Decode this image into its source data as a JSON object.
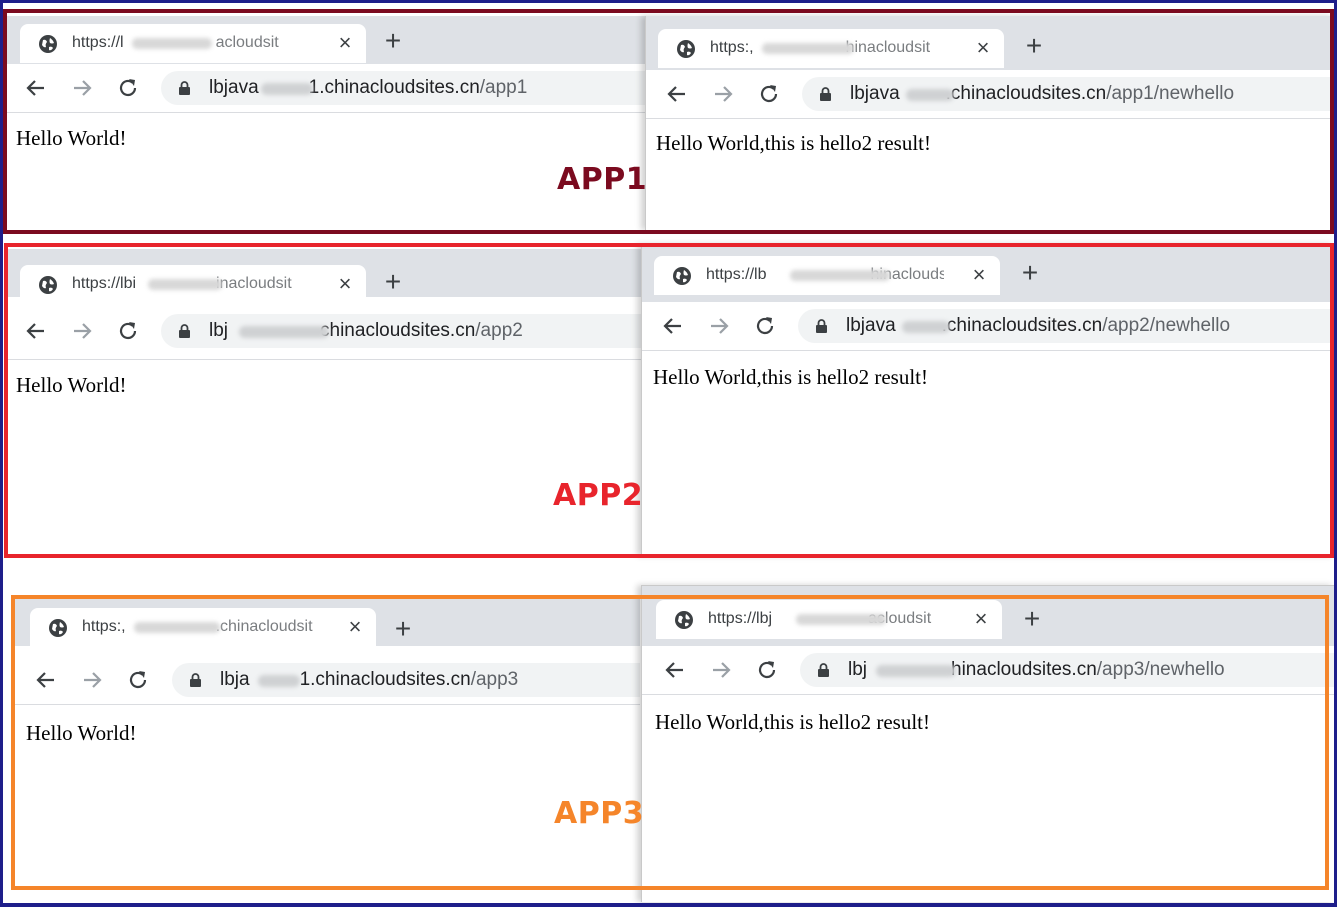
{
  "colors": {
    "app1": "#7b0a1f",
    "app2": "#e8242c",
    "app3": "#f5852a",
    "outer": "#1e1e8a"
  },
  "labels": {
    "app1": "APP1",
    "app2": "APP2",
    "app3": "APP3"
  },
  "windows": {
    "app1_left": {
      "tab_title_a": "https://l",
      "tab_title_b": "acloudsit",
      "url_host_a": "lbjava",
      "url_host_b": "1.chinacloudsites.cn",
      "url_path": "/app1",
      "content": "Hello World!"
    },
    "app1_right": {
      "tab_title_a": "https:,",
      "tab_title_b": "hinacloudsit",
      "url_host_a": "lbjava",
      "url_host_b": ".chinacloudsites.cn",
      "url_path": "/app1/newhello",
      "content": "Hello World,this is hello2 result!"
    },
    "app2_left": {
      "tab_title_a": "https://lbi",
      "tab_title_b": "inacloudsit",
      "url_host_a": "lbj",
      "url_host_b": "chinacloudsites.cn",
      "url_path": "/app2",
      "content": "Hello World!"
    },
    "app2_right": {
      "tab_title_a": "https://lb",
      "tab_title_b": "hinacloudsit",
      "url_host_a": "lbjava",
      "url_host_b": ".chinacloudsites.cn",
      "url_path": "/app2/newhello",
      "content": "Hello World,this is hello2 result!"
    },
    "app3_left": {
      "tab_title_a": "https:,",
      "tab_title_b": ".chinacloudsit",
      "url_host_a": "lbja",
      "url_host_b": "1.chinacloudsites.cn",
      "url_path": "/app3",
      "content": "Hello World!"
    },
    "app3_right": {
      "tab_title_a": "https://lbj",
      "tab_title_b": "acloudsit",
      "url_host_a": "lbj",
      "url_host_b": "hinacloudsites.cn",
      "url_path": "/app3/newhello",
      "content": "Hello World,this is hello2 result!"
    }
  },
  "icons": {
    "globe": "globe-icon",
    "close": "close-icon",
    "new_tab": "plus-icon",
    "back": "back-arrow-icon",
    "forward": "forward-arrow-icon",
    "reload": "reload-icon",
    "lock": "lock-icon"
  },
  "glyphs": {
    "close": "×",
    "plus": "+"
  }
}
